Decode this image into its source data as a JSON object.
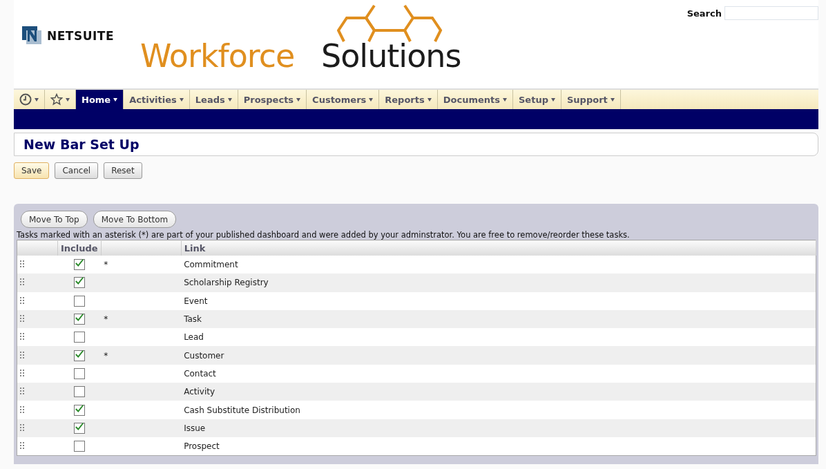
{
  "header": {
    "netsuite_logo": "NETSUITE",
    "brand_word_1": "Workforce",
    "brand_word_2": "Solutions",
    "search": {
      "label": "Search"
    }
  },
  "nav": {
    "icon_menus": [
      {
        "kind": "clock"
      },
      {
        "kind": "star"
      }
    ],
    "items": [
      {
        "label": "Home",
        "selected": true
      },
      {
        "label": "Activities",
        "selected": false
      },
      {
        "label": "Leads",
        "selected": false
      },
      {
        "label": "Prospects",
        "selected": false
      },
      {
        "label": "Customers",
        "selected": false
      },
      {
        "label": "Reports",
        "selected": false
      },
      {
        "label": "Documents",
        "selected": false
      },
      {
        "label": "Setup",
        "selected": false
      },
      {
        "label": "Support",
        "selected": false
      }
    ]
  },
  "page_title": "New Bar Set Up",
  "buttons": [
    {
      "label": "Save",
      "kind": "primary"
    },
    {
      "label": "Cancel",
      "kind": "normal"
    },
    {
      "label": "Reset",
      "kind": "normal"
    }
  ],
  "panel": {
    "buttons": [
      "Move To Top",
      "Move To Bottom"
    ],
    "note": "Tasks marked with an asterisk (*) are part of your published dashboard and were added by your adminstrator. You are free to remove/reorder these tasks.",
    "table": {
      "columns": [
        "Include",
        "Link"
      ],
      "rows": [
        {
          "checked": true,
          "mark": "*",
          "link": "Commitment"
        },
        {
          "checked": true,
          "link": "Scholarship Registry"
        },
        {
          "checked": false,
          "link": "Event"
        },
        {
          "checked": true,
          "mark": "*",
          "link": "Task"
        },
        {
          "checked": false,
          "link": "Lead"
        },
        {
          "checked": true,
          "mark": "*",
          "link": "Customer"
        },
        {
          "checked": false,
          "link": "Contact"
        },
        {
          "checked": false,
          "link": "Activity"
        },
        {
          "checked": true,
          "link": "Cash Substitute Distribution"
        },
        {
          "checked": true,
          "link": "Issue"
        },
        {
          "checked": false,
          "link": "Prospect"
        }
      ]
    }
  }
}
